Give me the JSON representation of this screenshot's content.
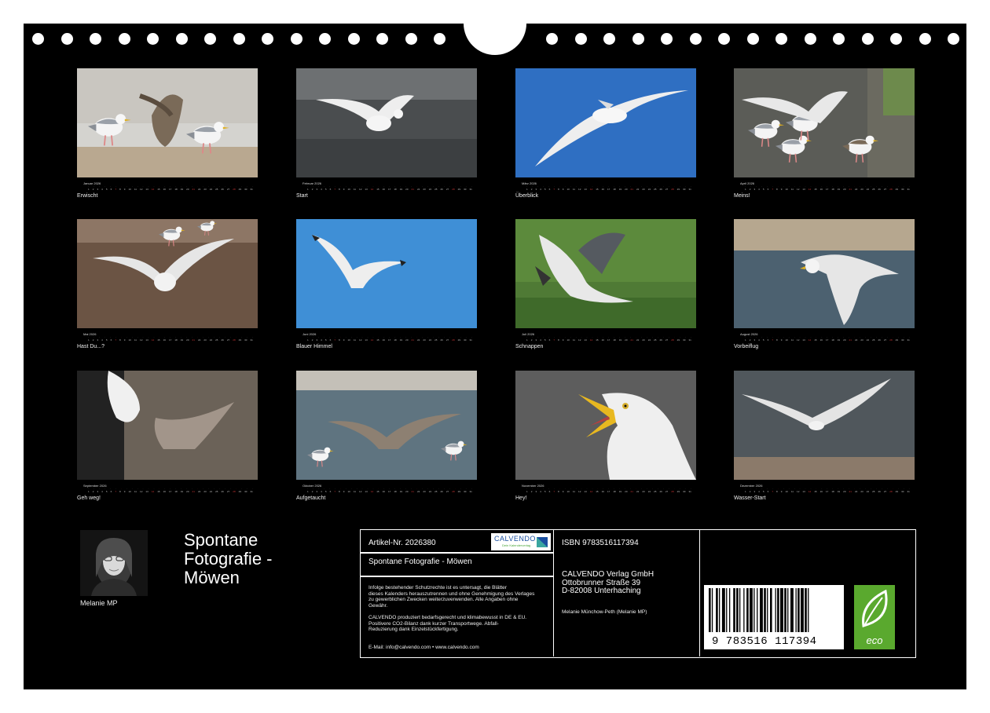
{
  "calendar": {
    "months": [
      {
        "month": "Januar 2026",
        "caption": "Erwischt",
        "scene": "fight-beach"
      },
      {
        "month": "Februar 2026",
        "caption": "Start",
        "scene": "takeoff-mud"
      },
      {
        "month": "März 2026",
        "caption": "Überblick",
        "scene": "flight-blue"
      },
      {
        "month": "April 2026",
        "caption": "Meins!",
        "scene": "group-pavement"
      },
      {
        "month": "Mai 2026",
        "caption": "Hast Du...?",
        "scene": "sand-group"
      },
      {
        "month": "Juni 2026",
        "caption": "Blauer Himmel",
        "scene": "flight-sky"
      },
      {
        "month": "Juli 2026",
        "caption": "Schnappen",
        "scene": "grass-wings"
      },
      {
        "month": "August 2026",
        "caption": "Vorbeiflug",
        "scene": "flyby-water"
      },
      {
        "month": "September 2026",
        "caption": "Geh weg!",
        "scene": "juvenile-fight"
      },
      {
        "month": "Oktober 2026",
        "caption": "Aufgetaucht",
        "scene": "water-wings"
      },
      {
        "month": "November 2026",
        "caption": "Hey!",
        "scene": "gull-head"
      },
      {
        "month": "Dezember 2026",
        "caption": "Wasser-Start",
        "scene": "water-takeoff"
      }
    ]
  },
  "author": {
    "name": "Melanie MP",
    "photo": "author-portrait"
  },
  "book": {
    "title_lines": [
      "Spontane",
      "Fotografie -",
      "Möwen"
    ]
  },
  "info": {
    "article": "Artikel-Nr. 2026380",
    "logo_text": "CALVENDO",
    "logo_sub": "Dein Kalenderverlag",
    "subtitle": "Spontane Fotografie - Möwen",
    "legal_lines": [
      "Infolge bestehender Schutzrechte ist es untersagt, die Blätter",
      "dieses Kalenders herauszutrennen und ohne Genehmigung des Verlages",
      "zu gewerblichen Zwecken weiterzuverwenden. Alle Angaben ohne",
      "Gewähr."
    ],
    "eco_lines": [
      "CALVENDO produziert bedarfsgerecht und klimabewusst in DE & EU.",
      "Positivere CO2-Bilanz dank kurzer Transportwege. Abfall-",
      "Reduzierung dank Einzelstückfertigung."
    ],
    "contact": "E-Mail: info@calvendo.com • www.calvendo.com",
    "isbn": "ISBN 9783516117394",
    "publisher_lines": [
      "CALVENDO Verlag GmbH",
      "Ottobrunner Straße 39",
      "D-82008 Unterhaching"
    ],
    "publisher_author": "Melanie Münchow-Peth (Melanie MP)",
    "barcode_number": "9 783516 117394",
    "eco_label": "eco"
  },
  "colors": {
    "background": "#000000",
    "text": "#ffffff",
    "eco_green": "#5aa92e",
    "logo_blue": "#1a4fa0"
  }
}
